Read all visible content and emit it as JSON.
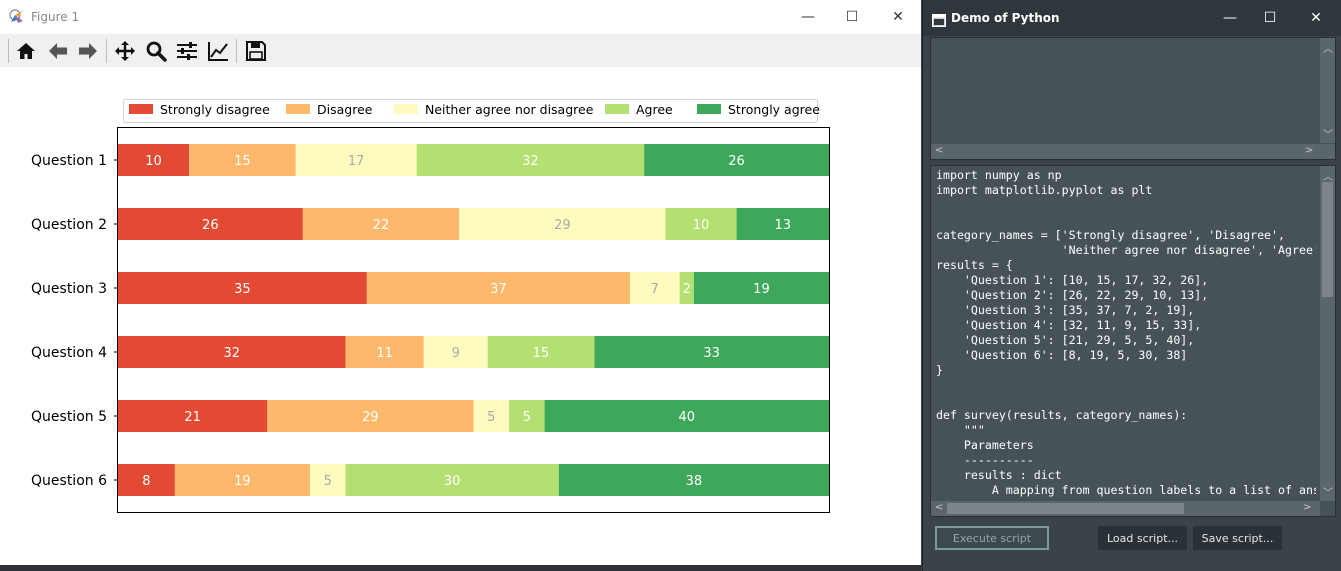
{
  "figure_window": {
    "title": "Figure 1",
    "controls": {
      "minimize": "—",
      "maximize": "☐",
      "close": "✕"
    },
    "toolbar": [
      "home-icon",
      "back-arrow-icon",
      "forward-arrow-icon",
      "pan-icon",
      "zoom-icon",
      "subplots-icon",
      "axes-edit-icon",
      "save-icon"
    ]
  },
  "python_window": {
    "title": "Demo of Python",
    "controls": {
      "minimize": "—",
      "maximize": "☐",
      "close": "✕"
    },
    "code": "import numpy as np\nimport matplotlib.pyplot as plt\n\n\ncategory_names = ['Strongly disagree', 'Disagree',\n                  'Neither agree nor disagree', 'Agree', 'Strongly agree']\nresults = {\n    'Question 1': [10, 15, 17, 32, 26],\n    'Question 2': [26, 22, 29, 10, 13],\n    'Question 3': [35, 37, 7, 2, 19],\n    'Question 4': [32, 11, 9, 15, 33],\n    'Question 5': [21, 29, 5, 5, 40],\n    'Question 6': [8, 19, 5, 30, 38]\n}\n\n\ndef survey(results, category_names):\n    \"\"\"\n    Parameters\n    ----------\n    results : dict\n        A mapping from question labels to a list of answers per category.",
    "buttons": {
      "execute": "Execute script",
      "load": "Load script...",
      "save": "Save script..."
    }
  },
  "chart_data": {
    "type": "bar",
    "orientation": "horizontal",
    "stacked": true,
    "categories": [
      "Question 1",
      "Question 2",
      "Question 3",
      "Question 4",
      "Question 5",
      "Question 6"
    ],
    "series": [
      {
        "name": "Strongly disagree",
        "color": "#e34a33",
        "label_color": "#ffffff",
        "values": [
          10,
          26,
          35,
          32,
          21,
          8
        ]
      },
      {
        "name": "Disagree",
        "color": "#fdb96b",
        "label_color": "#ffffff",
        "values": [
          15,
          22,
          37,
          11,
          29,
          19
        ]
      },
      {
        "name": "Neither agree nor disagree",
        "color": "#fefbbe",
        "label_color": "#aaaaaa",
        "values": [
          17,
          29,
          7,
          9,
          5,
          5
        ]
      },
      {
        "name": "Agree",
        "color": "#b4df71",
        "label_color": "#ffffff",
        "values": [
          32,
          10,
          2,
          15,
          5,
          30
        ]
      },
      {
        "name": "Strongly agree",
        "color": "#3ea85a",
        "label_color": "#ffffff",
        "values": [
          26,
          13,
          19,
          33,
          40,
          38
        ]
      }
    ],
    "xlim": [
      0,
      100
    ],
    "axes_visible": false,
    "y_inverted": true,
    "legend_position": "top-center",
    "grid": false,
    "data_labels": true
  }
}
